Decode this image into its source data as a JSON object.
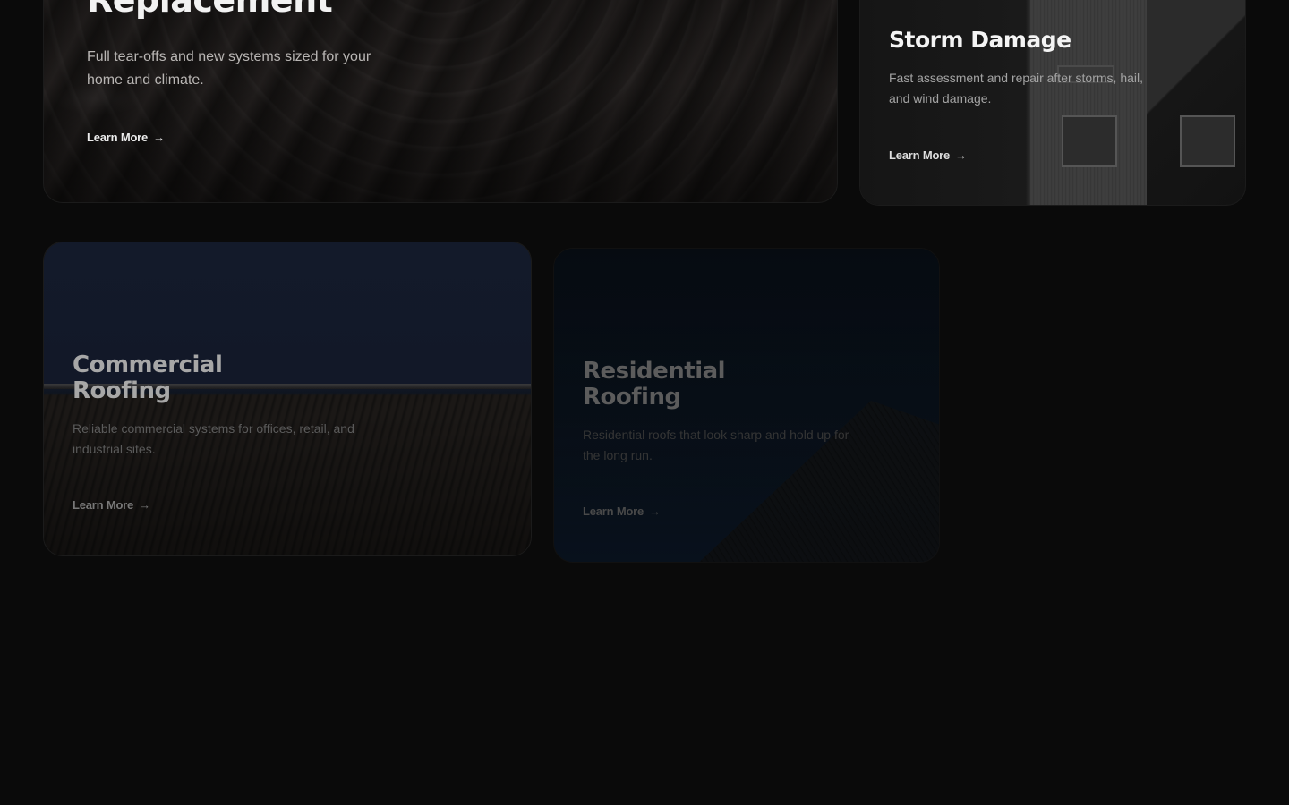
{
  "services": {
    "replacement": {
      "title": "Replacement",
      "description": "Full tear-offs and new systems sized for your home and climate.",
      "link_label": "Learn More",
      "arrow": "→"
    },
    "storm_damage": {
      "title": "Storm Damage",
      "description": "Fast assessment and repair after storms, hail, and wind damage.",
      "link_label": "Learn More",
      "arrow": "→"
    },
    "commercial": {
      "title_line1": "Commercial",
      "title_line2": "Roofing",
      "description": "Reliable commercial systems for offices, retail, and industrial sites.",
      "link_label": "Learn More",
      "arrow": "→"
    },
    "residential": {
      "title_line1": "Residential",
      "title_line2": "Roofing",
      "description": "Residential roofs that look sharp and hold up for the long run.",
      "link_label": "Learn More",
      "arrow": "→"
    }
  },
  "colors": {
    "page_background": "#0a0a0a",
    "card_border": "#1c1c1c",
    "commercial_sky": "#131a2a",
    "residential_sky": "#0a1420"
  }
}
